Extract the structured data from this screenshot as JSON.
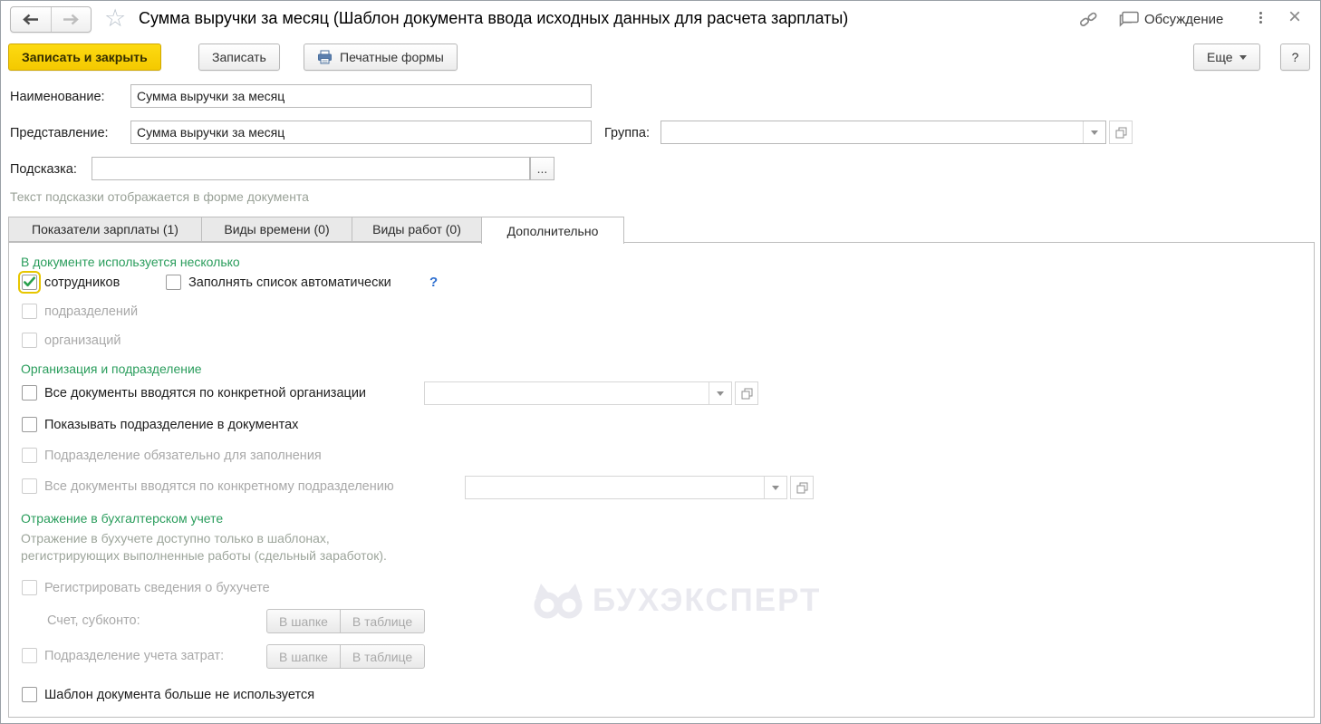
{
  "header": {
    "title": "Сумма выручки за месяц (Шаблон документа ввода исходных данных для расчета зарплаты)",
    "discussion": "Обсуждение"
  },
  "toolbar": {
    "save_and_close": "Записать и закрыть",
    "save": "Записать",
    "print_forms": "Печатные формы",
    "more": "Еще",
    "help": "?"
  },
  "form": {
    "name": {
      "label": "Наименование:",
      "value": "Сумма выручки за месяц"
    },
    "representation": {
      "label": "Представление:",
      "value": "Сумма выручки за месяц"
    },
    "group": {
      "label": "Группа:",
      "value": ""
    },
    "hint": {
      "label": "Подсказка:",
      "value": "",
      "more_button": "...",
      "note": "Текст подсказки отображается в форме документа"
    }
  },
  "tabs": {
    "salary_indicators": "Показатели зарплаты (1)",
    "time_types": "Виды времени (0)",
    "work_types": "Виды работ (0)",
    "additional": "Дополнительно"
  },
  "additional_tab": {
    "multi_section": {
      "header": "В документе используется несколько",
      "employees": "сотрудников",
      "fill_auto": "Заполнять список автоматически",
      "fill_auto_help": "?",
      "departments": "подразделений",
      "organizations": "организаций"
    },
    "org_section": {
      "header": "Организация и подразделение",
      "specific_org": "Все документы вводятся по конкретной организации",
      "specific_org_value": "",
      "show_dept": "Показывать подразделение в документах",
      "dept_required": "Подразделение обязательно для заполнения",
      "specific_dept": "Все документы вводятся по конкретному подразделению",
      "specific_dept_value": ""
    },
    "accounting_section": {
      "header": "Отражение в бухгалтерском учете",
      "note_line1": "Отражение в бухучете доступно только в шаблонах,",
      "note_line2": "регистрирующих выполненные работы (сдельный заработок).",
      "register_info": "Регистрировать сведения о бухучете",
      "account_subconto": "Счет, субконто:",
      "in_header": "В шапке",
      "in_table": "В таблице",
      "cost_dept": "Подразделение учета затрат:",
      "template_not_used": "Шаблон документа больше не используется"
    },
    "watermark": "БУХЭКСПЕРТ"
  },
  "colors": {
    "accent_green": "#2a9d5c",
    "check_green": "#2aa04d",
    "focus_yellow": "#e7c600",
    "primary_button_yellow": "#f4c900",
    "help_blue": "#2e6fd0",
    "disabled_gray": "#a9a9a9"
  }
}
